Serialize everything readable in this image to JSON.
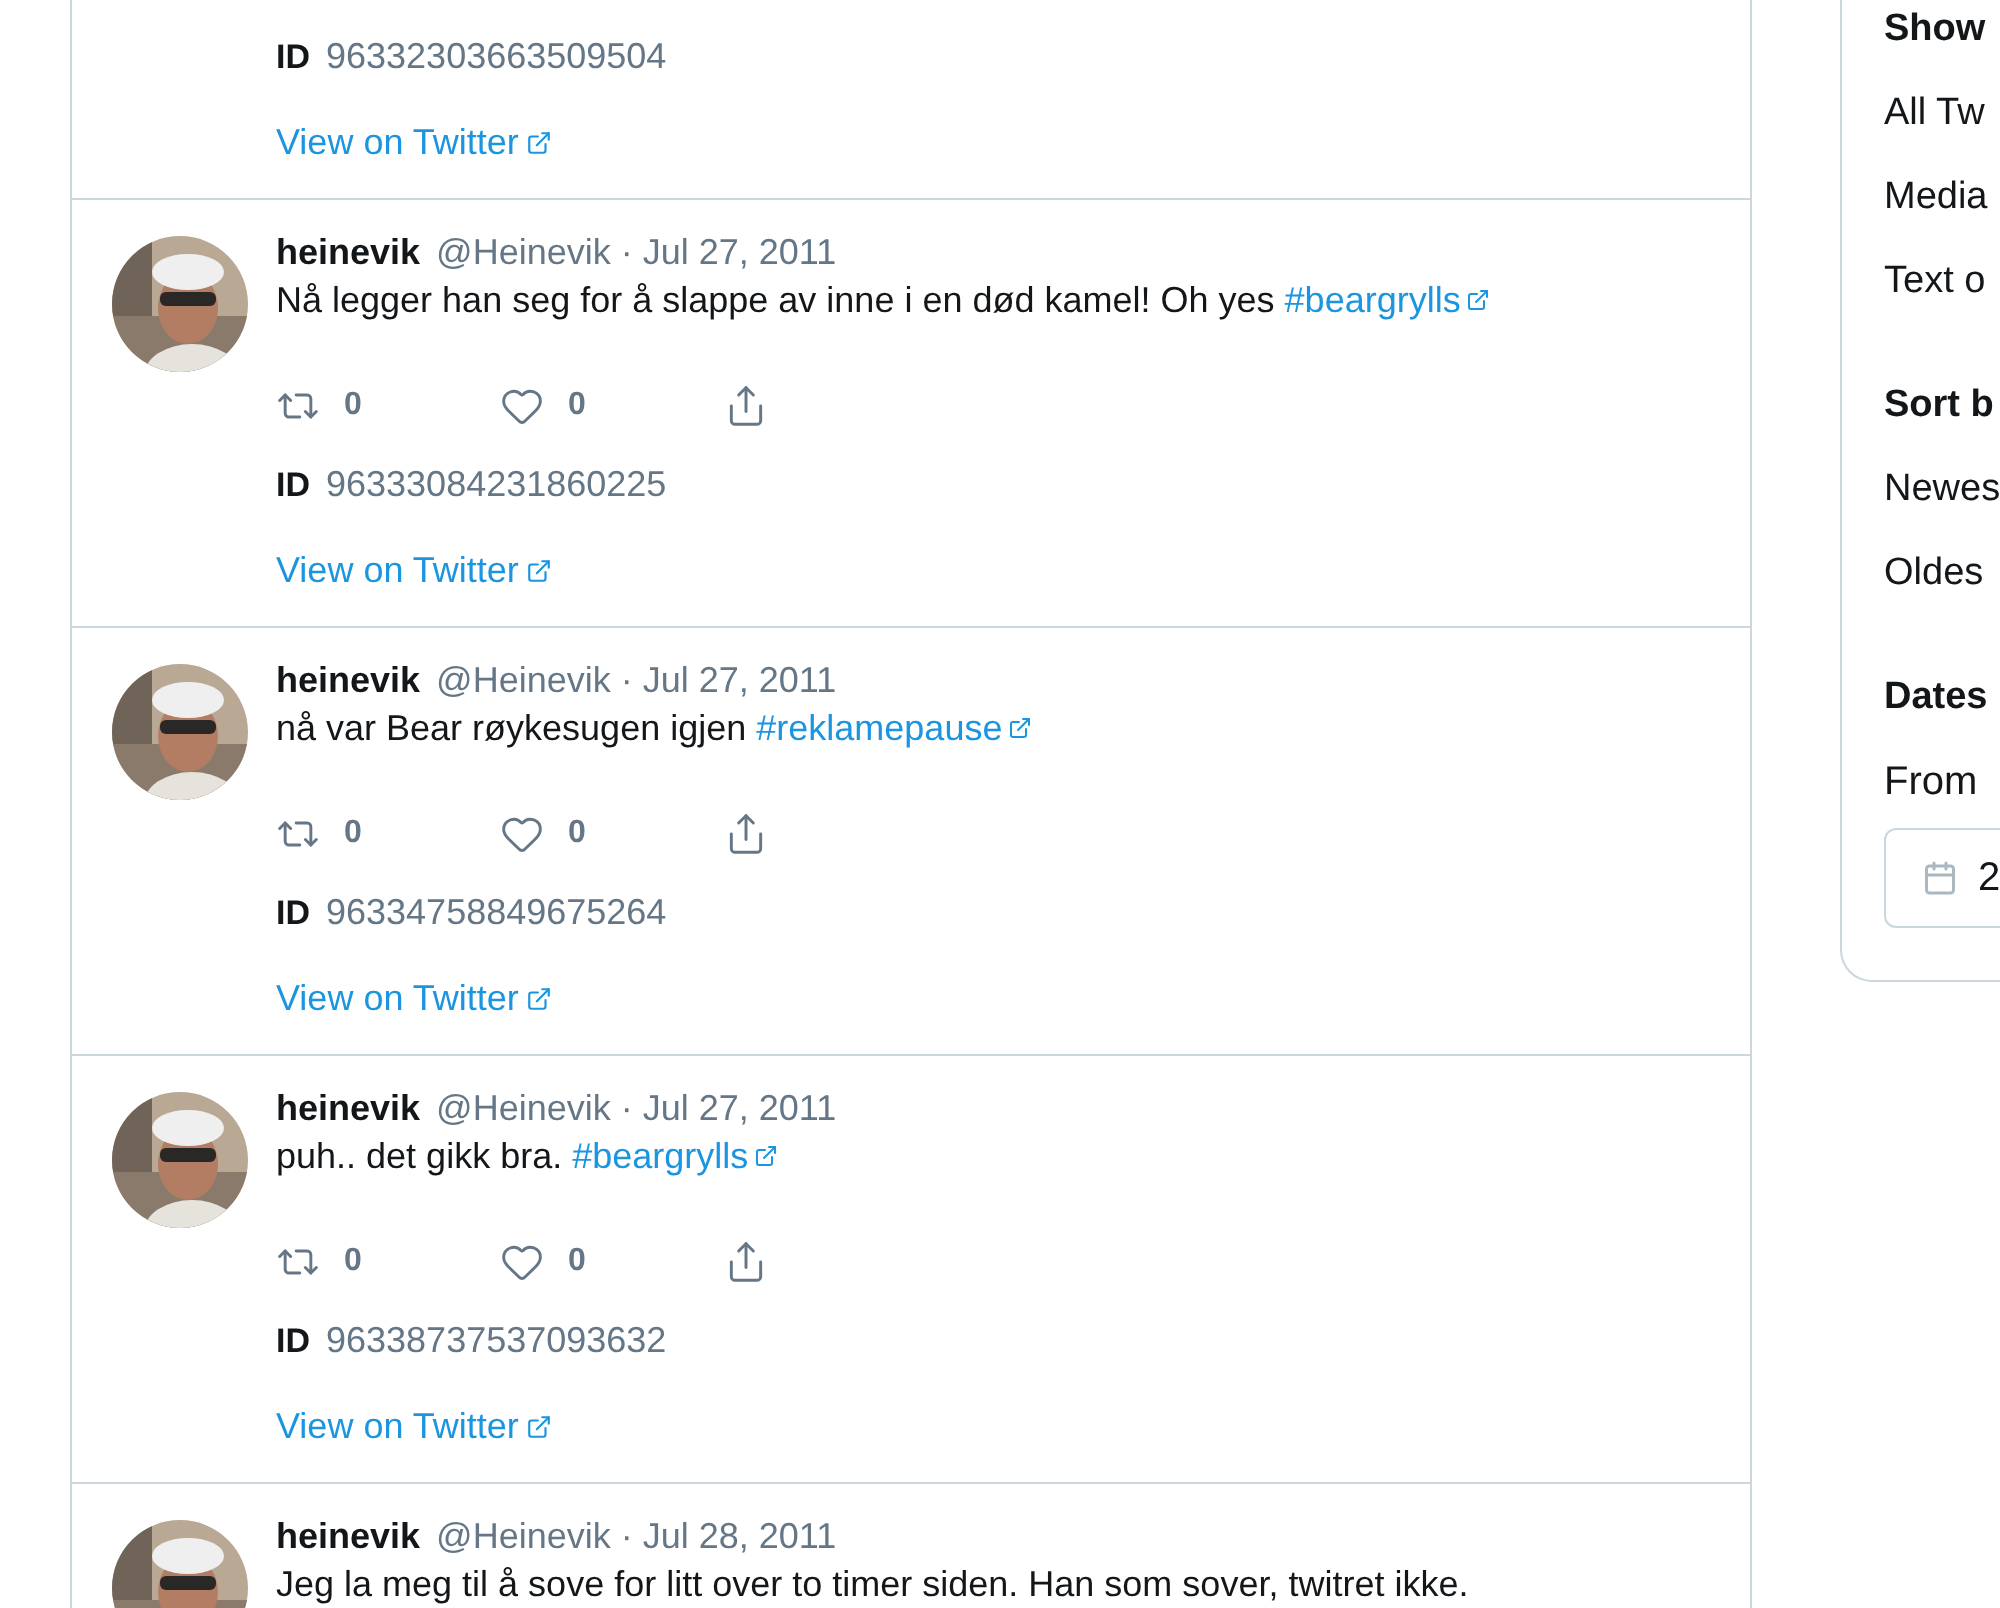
{
  "feed": {
    "tweets": [
      {
        "id_label": "ID",
        "id": "96332303663509504",
        "link": "View on Twitter"
      },
      {
        "name": "heinevik",
        "meta": "@Heinevik · Jul 27, 2011",
        "text": "Nå legger han seg for å slappe av inne i en død kamel! Oh yes ",
        "hashtag": "#beargrylls",
        "retweets": "0",
        "likes": "0",
        "id_label": "ID",
        "id": "96333084231860225",
        "link": "View on Twitter"
      },
      {
        "name": "heinevik",
        "meta": "@Heinevik · Jul 27, 2011",
        "text": "nå var Bear røykesugen igjen ",
        "hashtag": "#reklamepause",
        "retweets": "0",
        "likes": "0",
        "id_label": "ID",
        "id": "96334758849675264",
        "link": "View on Twitter"
      },
      {
        "name": "heinevik",
        "meta": "@Heinevik · Jul 27, 2011",
        "text": "puh.. det gikk bra. ",
        "hashtag": "#beargrylls",
        "retweets": "0",
        "likes": "0",
        "id_label": "ID",
        "id": "96338737537093632",
        "link": "View on Twitter"
      },
      {
        "name": "heinevik",
        "meta": "@Heinevik · Jul 28, 2011",
        "text": "Jeg la meg til å sove for litt over to timer siden. Han som sover, twitret ikke."
      }
    ]
  },
  "sidebar": {
    "sections": [
      {
        "heading": "Show",
        "options": [
          "All Tw",
          "Media",
          "Text o"
        ]
      },
      {
        "heading": "Sort b",
        "options": [
          "Newes",
          "Oldes"
        ]
      },
      {
        "heading": "Dates",
        "field_label": "From",
        "date_value": "2"
      }
    ]
  }
}
